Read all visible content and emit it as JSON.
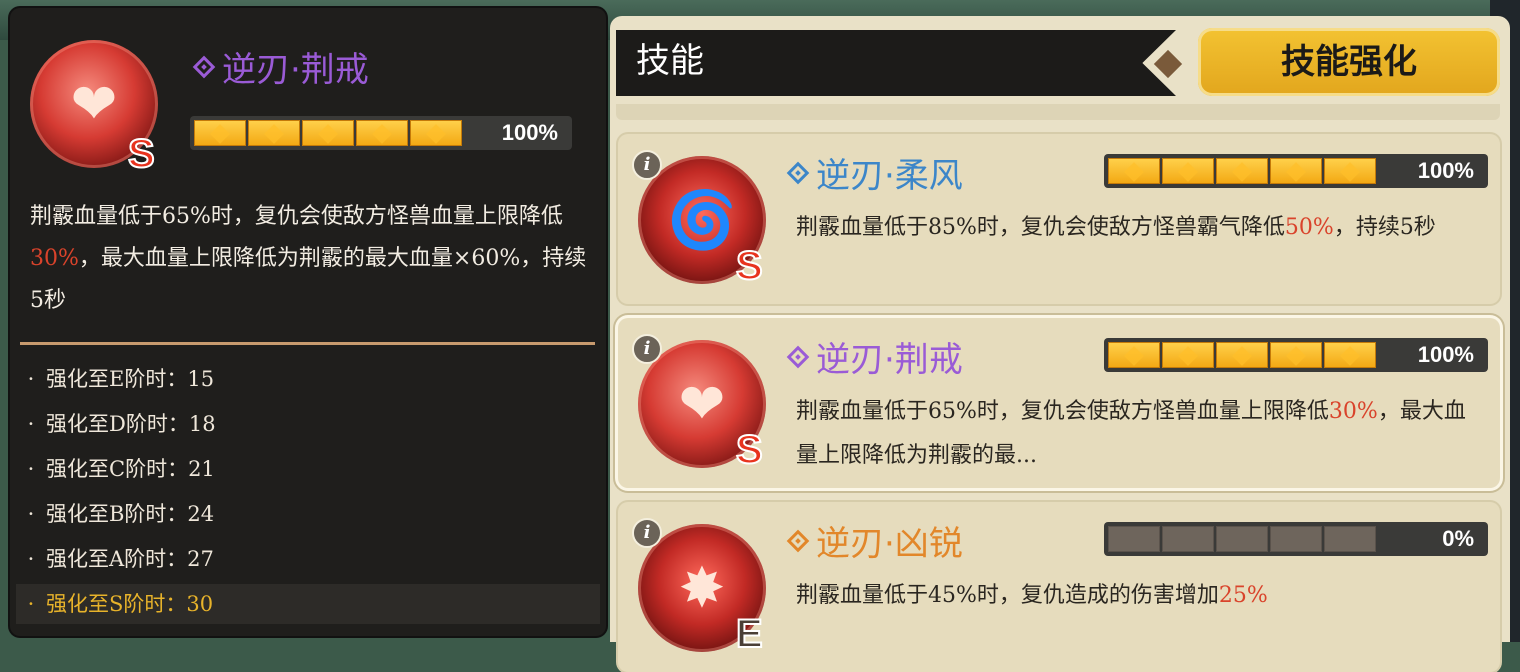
{
  "detail": {
    "skill_name": "逆刃·荆戒",
    "progress_pct": "100%",
    "progress_fraction": 1.0,
    "rank": "S",
    "icon": "heart-arrow-icon",
    "desc_part1": "荆霰血量低于65%时，复仇会使敌方怪兽血量上限降低",
    "desc_highlight": "30%",
    "desc_part2": "，最大血量上限降低为荆霰的最大血量×60%，持续5秒",
    "upgrades": [
      {
        "text": "强化至E阶时：15"
      },
      {
        "text": "强化至D阶时：18"
      },
      {
        "text": "强化至C阶时：21"
      },
      {
        "text": "强化至B阶时：24"
      },
      {
        "text": "强化至A阶时：27"
      },
      {
        "text": "强化至S阶时：30"
      }
    ]
  },
  "tabs": {
    "skill": "技能",
    "upgrade": "技能强化"
  },
  "skills": [
    {
      "name": "逆刃·柔风",
      "color": "#3c86c9",
      "rank": "S",
      "progress": "100%",
      "progress_fraction": 1.0,
      "icon": "thorn-swirl-icon",
      "desc_part1": "荆霰血量低于85%时，复仇会使敌方怪兽霸气降低",
      "desc_highlight": "50%",
      "desc_part2": "，持续5秒"
    },
    {
      "name": "逆刃·荆戒",
      "color": "#9a5bd6",
      "rank": "S",
      "progress": "100%",
      "progress_fraction": 1.0,
      "icon": "heart-arrow-icon",
      "desc_part1": "荆霰血量低于65%时，复仇会使敌方怪兽血量上限降低",
      "desc_highlight": "30%",
      "desc_part2": "，最大血量上限降低为荆霰的最..."
    },
    {
      "name": "逆刃·凶锐",
      "color": "#e2872a",
      "rank": "E",
      "progress": "0%",
      "progress_fraction": 0.0,
      "icon": "burst-icon",
      "desc_part1": "荆霰血量低于45%时，复仇造成的伤害增加",
      "desc_highlight": "25%",
      "desc_part2": ""
    }
  ],
  "info_label": "i"
}
